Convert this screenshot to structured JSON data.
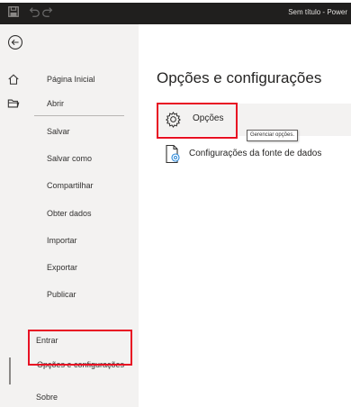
{
  "titlebar": {
    "title": "Sem título - Power"
  },
  "sidebar": {
    "items": [
      {
        "label": "Página Inicial",
        "icon": "home-icon"
      },
      {
        "label": "Abrir",
        "icon": "folder-icon"
      },
      {
        "label": "Salvar"
      },
      {
        "label": "Salvar como"
      },
      {
        "label": "Compartilhar"
      },
      {
        "label": "Obter dados"
      },
      {
        "label": "Importar"
      },
      {
        "label": "Exportar"
      },
      {
        "label": "Publicar"
      },
      {
        "label": "Entrar"
      },
      {
        "label": "Opções e configurações",
        "active": true
      },
      {
        "label": "Sobre"
      }
    ]
  },
  "main": {
    "title": "Opções e configurações",
    "options": [
      {
        "label": "Opções",
        "icon": "gear-icon",
        "tooltip": "Gerenciar opções."
      },
      {
        "label": "Configurações da fonte de dados",
        "icon": "data-source-settings-icon"
      }
    ]
  },
  "colors": {
    "highlight": "#e81123",
    "titlebar": "#201f1e",
    "sidebar": "#f3f2f1"
  }
}
